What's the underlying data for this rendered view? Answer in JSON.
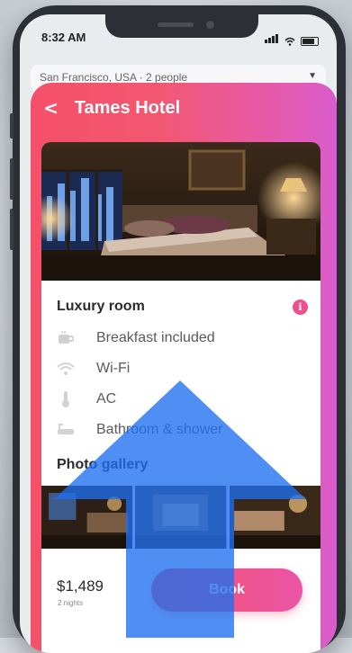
{
  "status": {
    "time": "8:32 AM"
  },
  "search": {
    "text": "San Francisco, USA · 2 people"
  },
  "header": {
    "title": "Tames Hotel"
  },
  "room": {
    "title": "Luxury room"
  },
  "amenities": [
    {
      "icon": "coffee-cup-icon",
      "label": "Breakfast included"
    },
    {
      "icon": "wifi-icon",
      "label": "Wi-Fi"
    },
    {
      "icon": "thermometer-icon",
      "label": "AC"
    },
    {
      "icon": "bathtub-icon",
      "label": "Bathroom & shower"
    }
  ],
  "gallery": {
    "title": "Photo gallery"
  },
  "booking": {
    "price": "$1,489",
    "nights": "2 nights",
    "book_label": "Book"
  },
  "colors": {
    "gradient_start": "#f5506a",
    "gradient_end": "#d95ccc",
    "overlay_arrow": "#1e6ff0"
  }
}
